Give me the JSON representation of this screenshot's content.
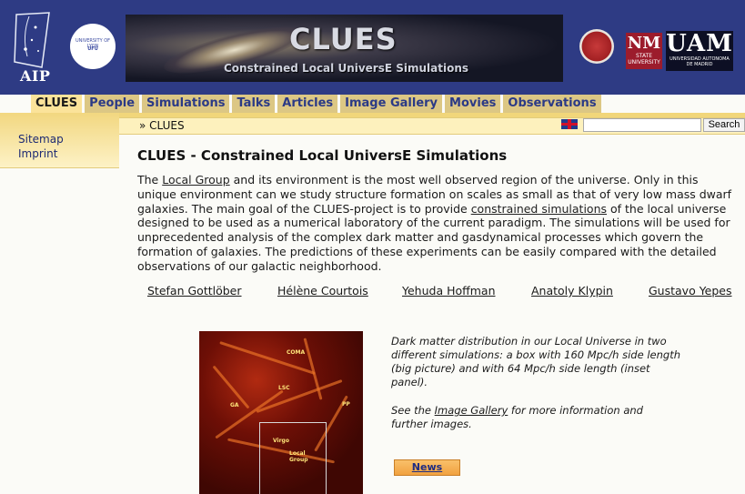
{
  "header": {
    "aip_label": "AIP",
    "uni_logo_line1": "UNIVERSITY OF LYON",
    "uni_logo_line2": "UFU",
    "banner_title": "CLUES",
    "banner_subtitle": "Constrained Local UniversE Simulations",
    "nm_logo_big": "NM",
    "nm_logo_small": "STATE UNIVERSITY",
    "uam_logo_big": "UAM",
    "uam_logo_small": "UNIVERSIDAD AUTONOMA DE MADRID"
  },
  "nav": {
    "tabs": [
      {
        "label": "CLUES"
      },
      {
        "label": "People"
      },
      {
        "label": "Simulations"
      },
      {
        "label": "Talks"
      },
      {
        "label": "Articles"
      },
      {
        "label": "Image Gallery"
      },
      {
        "label": "Movies"
      },
      {
        "label": "Observations"
      }
    ],
    "active_tab": "CLUES"
  },
  "breadcrumb": "» CLUES",
  "search": {
    "button": "Search",
    "value": ""
  },
  "sidebar": {
    "items": [
      {
        "label": "Sitemap"
      },
      {
        "label": "Imprint"
      }
    ]
  },
  "main": {
    "title": "CLUES - Constrained Local UniversE Simulations",
    "intro": {
      "p1": "The ",
      "link1": "Local Group",
      "p2": " and its environment is the most well observed region of the universe. Only in this unique environment can we study structure formation on scales as small as that of very low mass dwarf galaxies. The main goal of the CLUES-project is to provide ",
      "link2": "constrained simulations",
      "p3": " of the local universe designed to be used as a numerical laboratory of the current paradigm. The simulations will be used for unprecedented analysis of the complex dark matter and gasdynamical processes which govern the formation of galaxies. The predictions of these experiments can be easily compared with the detailed observations of our galactic neighborhood."
    },
    "people": [
      {
        "name": "Stefan Gottlöber"
      },
      {
        "name": "Hélène Courtois"
      },
      {
        "name": "Yehuda Hoffman"
      },
      {
        "name": "Anatoly Klypin"
      },
      {
        "name": "Gustavo Yepes"
      }
    ],
    "image_labels": {
      "coma": "COMA",
      "lsc": "LSC",
      "ga": "GA",
      "pp": "PP",
      "virgo": "Virgo",
      "local_group": "Local Group"
    },
    "caption": "Dark matter distribution in our Local Universe in two different simulations: a box with 160 Mpc/h side length (big picture) and with 64 Mpc/h side length (inset panel).",
    "see_prefix": "See the ",
    "gallery_link": "Image Gallery",
    "see_suffix": " for more information and further images.",
    "news_button": "News"
  }
}
